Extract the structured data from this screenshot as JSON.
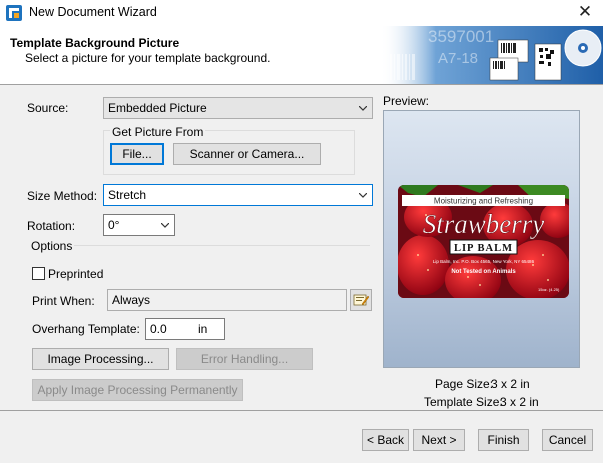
{
  "window": {
    "title": "New Document Wizard",
    "close": "✕"
  },
  "header": {
    "title": "Template Background Picture",
    "subtitle": "Select a picture for your template background."
  },
  "source": {
    "label": "Source:",
    "value": "Embedded Picture"
  },
  "get_picture": {
    "label": "Get Picture From",
    "file_button": "File...",
    "scanner_button": "Scanner or Camera..."
  },
  "size_method": {
    "label": "Size Method:",
    "value": "Stretch"
  },
  "rotation": {
    "label": "Rotation:",
    "value": "0°"
  },
  "options": {
    "label": "Options",
    "preprinted": {
      "label": "Preprinted",
      "checked": false
    },
    "print_when": {
      "label": "Print When:",
      "value": "Always"
    },
    "overhang": {
      "label": "Overhang Template:",
      "value": "0.0",
      "unit": "in"
    },
    "image_processing_button": "Image Processing...",
    "error_handling_button": "Error Handling...",
    "apply_permanently_button": "Apply Image Processing Permanently"
  },
  "preview": {
    "label": "Preview:",
    "image": {
      "top_text": "Moisturizing and Refreshing",
      "brand": "Strawberry",
      "product": "LIP BALM",
      "address": "Lip Balm, Inc. P.O. Box 4565, New York, NY 65486",
      "tagline": "Not Tested on Animals",
      "size": "15oz. (4.25)"
    },
    "page_size_label": "Page Size:",
    "page_size_value": "3 x 2 in",
    "template_size_label": "Template Size:",
    "template_size_value": "3 x 2 in"
  },
  "footer": {
    "back": "< Back",
    "next": "Next >",
    "finish": "Finish",
    "cancel": "Cancel"
  },
  "header_art": {
    "text1": "3597001",
    "text2": "A7-18"
  },
  "colors": {
    "accent": "#0078d7",
    "label_red": "#c8102e"
  }
}
